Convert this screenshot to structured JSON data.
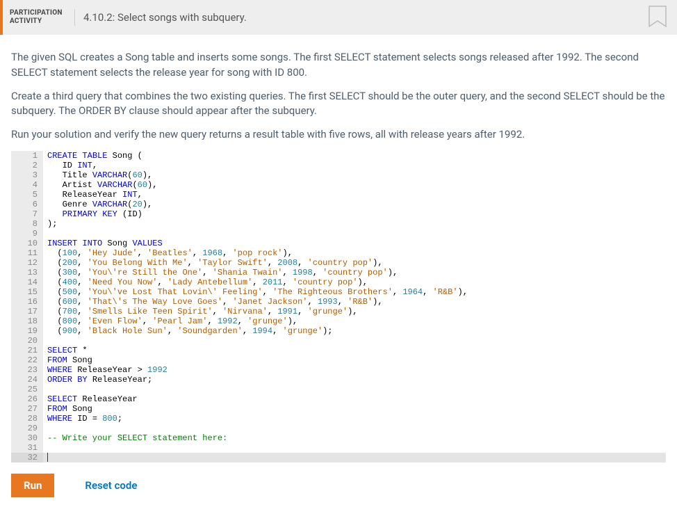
{
  "header": {
    "activity_label_line1": "PARTICIPATION",
    "activity_label_line2": "ACTIVITY",
    "activity_number": "4.10.2:",
    "activity_title": "Select songs with subquery."
  },
  "description": {
    "p1": "The given SQL creates a Song table and inserts some songs. The first SELECT statement selects songs released after 1992. The second SELECT statement selects the release year for song with ID 800.",
    "p2": "Create a third query that combines the two existing queries. The first SELECT should be the outer query, and the second SELECT should be the subquery. The ORDER BY clause should appear after the subquery.",
    "p3": "Run your solution and verify the new query returns a result table with five rows, all with release years after 1992."
  },
  "code": {
    "lines": [
      [
        [
          "kw",
          "CREATE"
        ],
        [
          "p",
          " "
        ],
        [
          "kw",
          "TABLE"
        ],
        [
          "p",
          " Song ("
        ]
      ],
      [
        [
          "p",
          "   ID "
        ],
        [
          "type",
          "INT"
        ],
        [
          "p",
          ","
        ]
      ],
      [
        [
          "p",
          "   Title "
        ],
        [
          "type",
          "VARCHAR"
        ],
        [
          "p",
          "("
        ],
        [
          "num",
          "60"
        ],
        [
          "p",
          "),"
        ]
      ],
      [
        [
          "p",
          "   Artist "
        ],
        [
          "type",
          "VARCHAR"
        ],
        [
          "p",
          "("
        ],
        [
          "num",
          "60"
        ],
        [
          "p",
          "),"
        ]
      ],
      [
        [
          "p",
          "   ReleaseYear "
        ],
        [
          "type",
          "INT"
        ],
        [
          "p",
          ","
        ]
      ],
      [
        [
          "p",
          "   Genre "
        ],
        [
          "type",
          "VARCHAR"
        ],
        [
          "p",
          "("
        ],
        [
          "num",
          "20"
        ],
        [
          "p",
          "),"
        ]
      ],
      [
        [
          "p",
          "   "
        ],
        [
          "kw",
          "PRIMARY"
        ],
        [
          "p",
          " "
        ],
        [
          "kw",
          "KEY"
        ],
        [
          "p",
          " (ID)"
        ]
      ],
      [
        [
          "p",
          ");"
        ]
      ],
      [
        [
          "p",
          ""
        ]
      ],
      [
        [
          "kw",
          "INSERT"
        ],
        [
          "p",
          " "
        ],
        [
          "kw",
          "INTO"
        ],
        [
          "p",
          " Song "
        ],
        [
          "kw",
          "VALUES"
        ]
      ],
      [
        [
          "p",
          "  ("
        ],
        [
          "num",
          "100"
        ],
        [
          "p",
          ", "
        ],
        [
          "str",
          "'Hey Jude'"
        ],
        [
          "p",
          ", "
        ],
        [
          "str",
          "'Beatles'"
        ],
        [
          "p",
          ", "
        ],
        [
          "num",
          "1968"
        ],
        [
          "p",
          ", "
        ],
        [
          "str",
          "'pop rock'"
        ],
        [
          "p",
          "),"
        ]
      ],
      [
        [
          "p",
          "  ("
        ],
        [
          "num",
          "200"
        ],
        [
          "p",
          ", "
        ],
        [
          "str",
          "'You Belong With Me'"
        ],
        [
          "p",
          ", "
        ],
        [
          "str",
          "'Taylor Swift'"
        ],
        [
          "p",
          ", "
        ],
        [
          "num",
          "2008"
        ],
        [
          "p",
          ", "
        ],
        [
          "str",
          "'country pop'"
        ],
        [
          "p",
          "),"
        ]
      ],
      [
        [
          "p",
          "  ("
        ],
        [
          "num",
          "300"
        ],
        [
          "p",
          ", "
        ],
        [
          "str",
          "'You\\'re Still the One'"
        ],
        [
          "p",
          ", "
        ],
        [
          "str",
          "'Shania Twain'"
        ],
        [
          "p",
          ", "
        ],
        [
          "num",
          "1998"
        ],
        [
          "p",
          ", "
        ],
        [
          "str",
          "'country pop'"
        ],
        [
          "p",
          "),"
        ]
      ],
      [
        [
          "p",
          "  ("
        ],
        [
          "num",
          "400"
        ],
        [
          "p",
          ", "
        ],
        [
          "str",
          "'Need You Now'"
        ],
        [
          "p",
          ", "
        ],
        [
          "str",
          "'Lady Antebellum'"
        ],
        [
          "p",
          ", "
        ],
        [
          "num",
          "2011"
        ],
        [
          "p",
          ", "
        ],
        [
          "str",
          "'country pop'"
        ],
        [
          "p",
          "),"
        ]
      ],
      [
        [
          "p",
          "  ("
        ],
        [
          "num",
          "500"
        ],
        [
          "p",
          ", "
        ],
        [
          "str",
          "'You\\'ve Lost That Lovin\\' Feeling'"
        ],
        [
          "p",
          ", "
        ],
        [
          "str",
          "'The Righteous Brothers'"
        ],
        [
          "p",
          ", "
        ],
        [
          "num",
          "1964"
        ],
        [
          "p",
          ", "
        ],
        [
          "str",
          "'R&B'"
        ],
        [
          "p",
          "),"
        ]
      ],
      [
        [
          "p",
          "  ("
        ],
        [
          "num",
          "600"
        ],
        [
          "p",
          ", "
        ],
        [
          "str",
          "'That\\'s The Way Love Goes'"
        ],
        [
          "p",
          ", "
        ],
        [
          "str",
          "'Janet Jackson'"
        ],
        [
          "p",
          ", "
        ],
        [
          "num",
          "1993"
        ],
        [
          "p",
          ", "
        ],
        [
          "str",
          "'R&B'"
        ],
        [
          "p",
          "),"
        ]
      ],
      [
        [
          "p",
          "  ("
        ],
        [
          "num",
          "700"
        ],
        [
          "p",
          ", "
        ],
        [
          "str",
          "'Smells Like Teen Spirit'"
        ],
        [
          "p",
          ", "
        ],
        [
          "str",
          "'Nirvana'"
        ],
        [
          "p",
          ", "
        ],
        [
          "num",
          "1991"
        ],
        [
          "p",
          ", "
        ],
        [
          "str",
          "'grunge'"
        ],
        [
          "p",
          "),"
        ]
      ],
      [
        [
          "p",
          "  ("
        ],
        [
          "num",
          "800"
        ],
        [
          "p",
          ", "
        ],
        [
          "str",
          "'Even Flow'"
        ],
        [
          "p",
          ", "
        ],
        [
          "str",
          "'Pearl Jam'"
        ],
        [
          "p",
          ", "
        ],
        [
          "num",
          "1992"
        ],
        [
          "p",
          ", "
        ],
        [
          "str",
          "'grunge'"
        ],
        [
          "p",
          "),"
        ]
      ],
      [
        [
          "p",
          "  ("
        ],
        [
          "num",
          "900"
        ],
        [
          "p",
          ", "
        ],
        [
          "str",
          "'Black Hole Sun'"
        ],
        [
          "p",
          ", "
        ],
        [
          "str",
          "'Soundgarden'"
        ],
        [
          "p",
          ", "
        ],
        [
          "num",
          "1994"
        ],
        [
          "p",
          ", "
        ],
        [
          "str",
          "'grunge'"
        ],
        [
          "p",
          ");"
        ]
      ],
      [
        [
          "p",
          ""
        ]
      ],
      [
        [
          "kw",
          "SELECT"
        ],
        [
          "p",
          " *"
        ]
      ],
      [
        [
          "kw",
          "FROM"
        ],
        [
          "p",
          " Song"
        ]
      ],
      [
        [
          "kw",
          "WHERE"
        ],
        [
          "p",
          " ReleaseYear > "
        ],
        [
          "num",
          "1992"
        ]
      ],
      [
        [
          "kw",
          "ORDER"
        ],
        [
          "p",
          " "
        ],
        [
          "kw",
          "BY"
        ],
        [
          "p",
          " ReleaseYear;"
        ]
      ],
      [
        [
          "p",
          ""
        ]
      ],
      [
        [
          "kw",
          "SELECT"
        ],
        [
          "p",
          " ReleaseYear"
        ]
      ],
      [
        [
          "kw",
          "FROM"
        ],
        [
          "p",
          " Song"
        ]
      ],
      [
        [
          "kw",
          "WHERE"
        ],
        [
          "p",
          " ID = "
        ],
        [
          "num",
          "800"
        ],
        [
          "p",
          ";"
        ]
      ],
      [
        [
          "p",
          ""
        ]
      ],
      [
        [
          "com",
          "-- Write your SELECT statement here:"
        ]
      ],
      [
        [
          "p",
          ""
        ]
      ],
      [
        [
          "p",
          ""
        ]
      ]
    ],
    "active_line": 32
  },
  "buttons": {
    "run": "Run",
    "reset": "Reset code"
  }
}
